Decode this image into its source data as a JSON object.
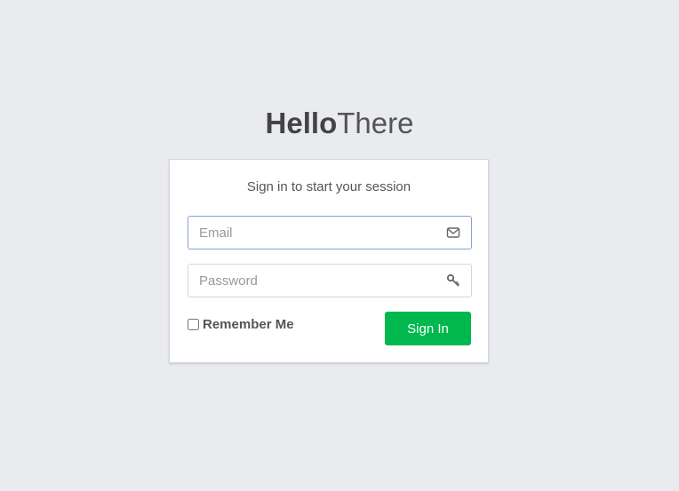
{
  "logo": {
    "part1": "Hello",
    "part2": "There"
  },
  "login": {
    "message": "Sign in to start your session",
    "email": {
      "placeholder": "Email",
      "value": "",
      "icon": "envelope-icon"
    },
    "password": {
      "placeholder": "Password",
      "value": "",
      "icon": "key-icon"
    },
    "remember_label": "Remember Me",
    "remember_checked": false,
    "signin_label": "Sign In"
  },
  "colors": {
    "background": "#e9ebee",
    "primary_button": "#00b84d",
    "focus_border": "#8a9fd8"
  }
}
